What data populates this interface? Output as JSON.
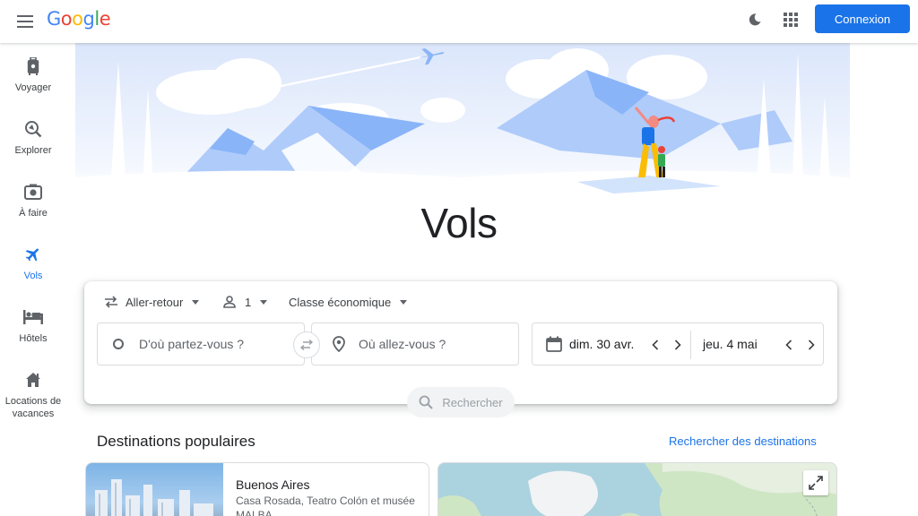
{
  "header": {
    "logo_letters": [
      {
        "ch": "G",
        "color": "#4285f4"
      },
      {
        "ch": "o",
        "color": "#ea4335"
      },
      {
        "ch": "o",
        "color": "#fbbc05"
      },
      {
        "ch": "g",
        "color": "#4285f4"
      },
      {
        "ch": "l",
        "color": "#34a853"
      },
      {
        "ch": "e",
        "color": "#ea4335"
      }
    ],
    "signin_label": "Connexion",
    "icons": [
      "menu-icon",
      "dark-theme-icon",
      "apps-grid-icon"
    ]
  },
  "sidebar": {
    "items": [
      {
        "label": "Voyager",
        "icon": "luggage-icon",
        "active": false
      },
      {
        "label": "Explorer",
        "icon": "explore-icon",
        "active": false
      },
      {
        "label": "À faire",
        "icon": "camera-icon",
        "active": false
      },
      {
        "label": "Vols",
        "icon": "flight-icon",
        "active": true
      },
      {
        "label": "Hôtels",
        "icon": "hotel-icon",
        "active": false
      },
      {
        "label": "Locations de vacances",
        "icon": "house-icon",
        "active": false
      }
    ]
  },
  "page_title": "Vols",
  "search": {
    "trip_type": "Aller-retour",
    "passengers": "1",
    "cabin_class": "Classe économique",
    "origin_placeholder": "D'où partez-vous ?",
    "destination_placeholder": "Où allez-vous ?",
    "departure_date": "dim. 30 avr.",
    "return_date": "jeu. 4 mai",
    "search_label": "Rechercher"
  },
  "destinations": {
    "title": "Destinations populaires",
    "link_label": "Rechercher des destinations",
    "cards": [
      {
        "name": "Buenos Aires",
        "description": "Casa Rosada, Teatro Colón et musée MALBA"
      }
    ]
  },
  "colors": {
    "accent": "#1a73e8",
    "hero_blue": "#aecbfa",
    "hero_light": "#e8f0fe"
  }
}
